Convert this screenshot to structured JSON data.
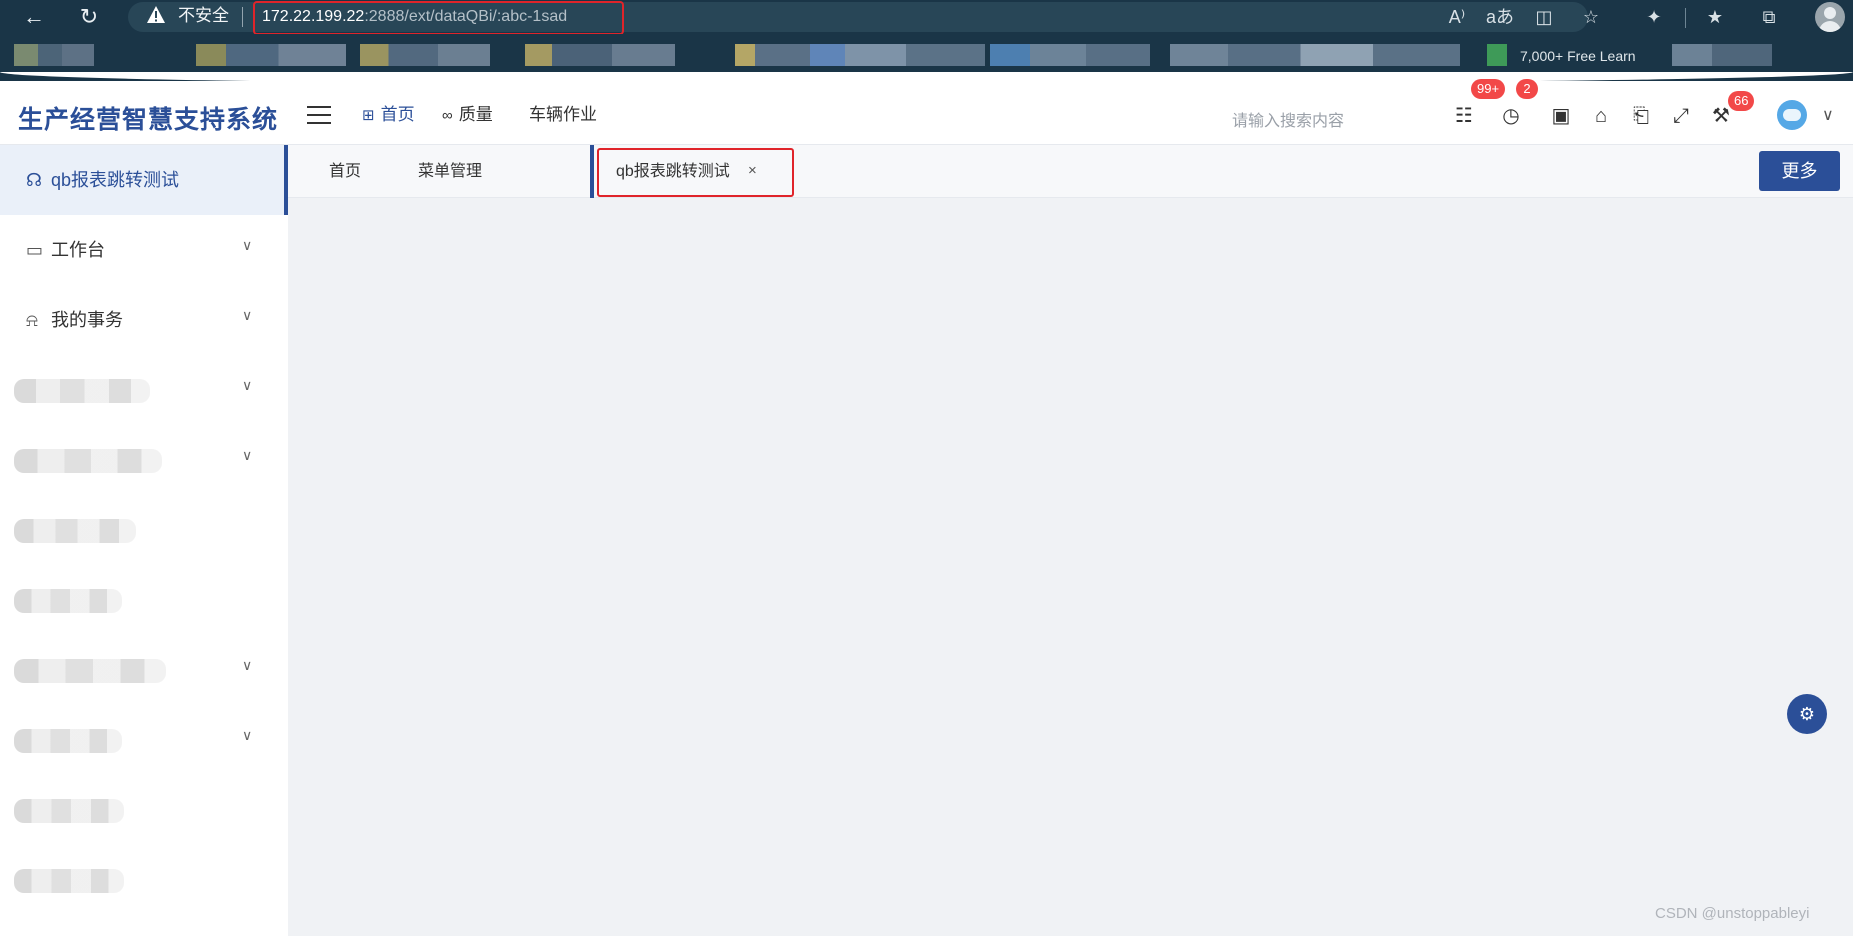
{
  "browser": {
    "back_glyph": "←",
    "reload_glyph": "↻",
    "security_label": "不安全",
    "url_host": "172.22.199.22",
    "url_rest": ":2888/ext/dataQBi/:abc-1sad",
    "bookmark_partial_text": "7,000+ Free Learn",
    "toolbar_icons": [
      "read-aloud-icon",
      "translate-icon",
      "split-screen-icon",
      "add-favorite-icon",
      "extensions-icon",
      "favorites-icon",
      "collections-icon",
      "profile-icon"
    ],
    "toolbar_glyphs": [
      "A⁾",
      "aあ",
      "◫",
      "☆",
      "✦",
      "★",
      "⧉"
    ]
  },
  "header": {
    "brand": "生产经营智慧支持系统",
    "menus": [
      {
        "icon": "grid-icon",
        "glyph": "⊞",
        "label": "首页",
        "active": true
      },
      {
        "icon": "glasses-icon",
        "glyph": "∞",
        "label": "质量",
        "active": false
      },
      {
        "icon": "",
        "glyph": "",
        "label": "车辆作业",
        "active": false
      }
    ],
    "search_placeholder": "请输入搜索内容",
    "icons": [
      {
        "name": "notice-icon",
        "glyph": "☷",
        "badge": "99+"
      },
      {
        "name": "alarm-icon",
        "glyph": "◷",
        "badge": "2"
      },
      {
        "name": "lock-icon",
        "glyph": "▣",
        "badge": ""
      },
      {
        "name": "theme-shirt-icon",
        "glyph": "⌂",
        "badge": ""
      },
      {
        "name": "language-icon",
        "glyph": "⎗",
        "badge": ""
      },
      {
        "name": "fullscreen-icon",
        "glyph": "⤢",
        "badge": ""
      },
      {
        "name": "tools-icon",
        "glyph": "⚒",
        "badge": "66"
      }
    ],
    "avatar_caret": "∨"
  },
  "sidebar": {
    "items": [
      {
        "icon": "headset-icon",
        "glyph": "☊",
        "label": "qb报表跳转测试",
        "caret": "",
        "active": true
      },
      {
        "icon": "monitor-icon",
        "glyph": "▭",
        "label": "工作台",
        "caret": "∨",
        "active": false
      },
      {
        "icon": "bell-icon",
        "glyph": "⍾",
        "label": "我的事务",
        "caret": "∨",
        "active": false
      }
    ],
    "blurred_caret": "∨"
  },
  "tabs": {
    "items": [
      "首页",
      "菜单管理",
      "qb报表跳转测试"
    ],
    "close_glyph": "×",
    "more_label": "更多"
  },
  "content": {
    "settings_glyph": "⚙",
    "watermark": "CSDN @unstoppableyi"
  }
}
